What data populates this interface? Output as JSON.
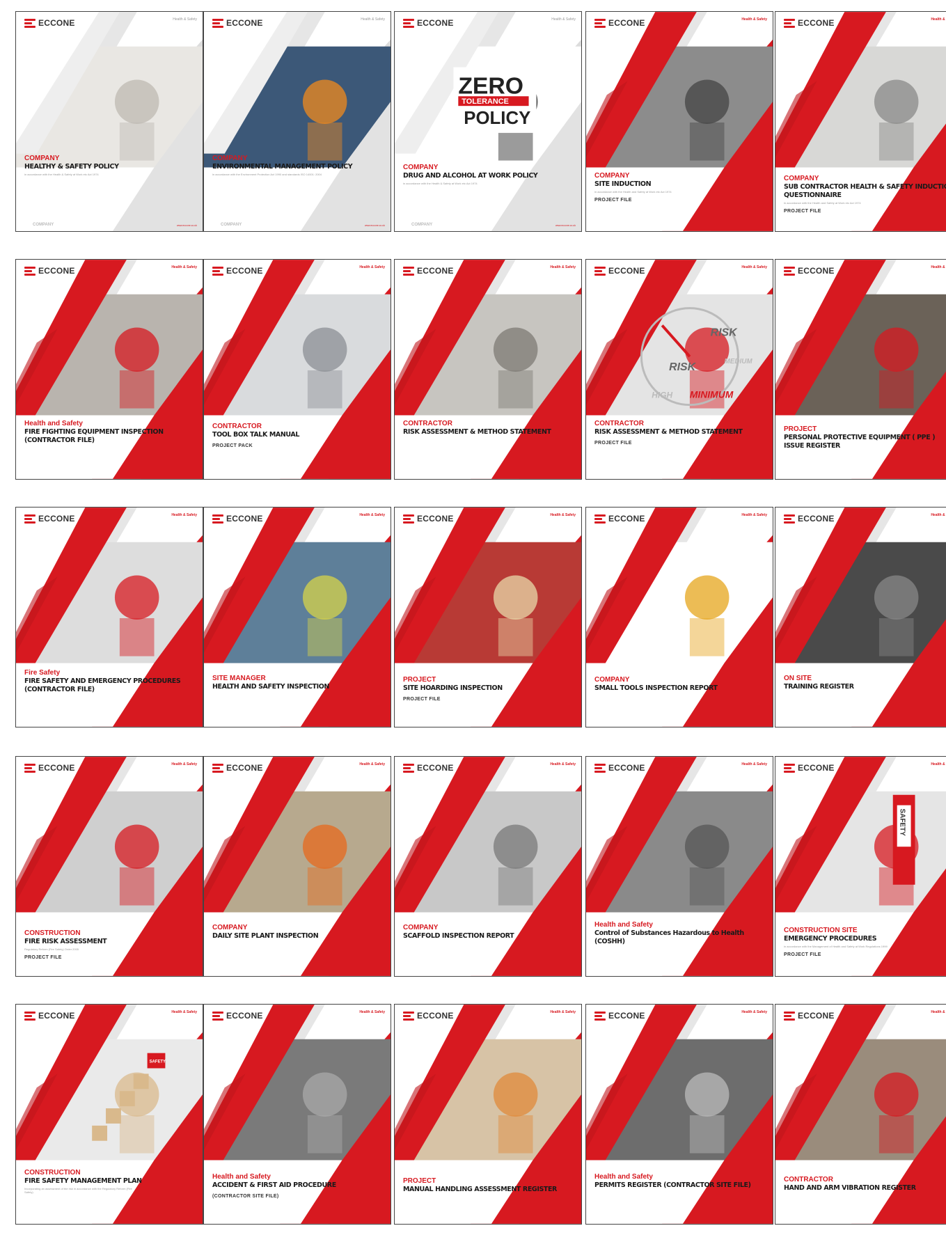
{
  "brand": {
    "logo_text": "ECCONE"
  },
  "covers": [
    {
      "category": "COMPANY",
      "title": "HEALTHY & SAFETY POLICY",
      "subtitle": "in accordance with the Health & Safety at Work etc Act 1974",
      "extra": "",
      "tag": "Health & Safety",
      "footer_left": "COMPANY",
      "footer_right": "www.eccone.co.uk",
      "photo": "pen-on-paper"
    },
    {
      "category": "COMPANY",
      "title": "ENVIRONMENTAL MANAGEMENT POLICY",
      "subtitle": "in accordance with the Environment Protection Act 1990 and standards ISO 14001: 2004",
      "extra": "",
      "tag": "Health & Safety",
      "footer_left": "COMPANY",
      "footer_right": "www.eccone.co.uk",
      "photo": "hard-hat-solar"
    },
    {
      "category": "COMPANY",
      "title": "DRUG AND ALCOHOL AT WORK POLICY",
      "subtitle": "in accordance with the Health & Safety at Work etc Act 1974",
      "extra": "",
      "tag": "Health & Safety",
      "footer_left": "COMPANY",
      "footer_right": "www.eccone.co.uk",
      "photo": "zero-tolerance",
      "poster": {
        "line1": "ZERO",
        "line2": "TOLERANCE",
        "line3": "POLICY"
      }
    },
    {
      "category": "COMPANY",
      "title": "SITE INDUCTION",
      "subtitle": "in accordance with the Health and Safety at Work etc Act 1974",
      "extra": "PROJECT FILE",
      "tag": "Health & Safety",
      "photo": "worker-face"
    },
    {
      "category": "COMPANY",
      "title": "SUB CONTRACTOR HEALTH & SAFETY INDUCTION QUESTIONNAIRE",
      "subtitle": "in accordance with the Health and Safety at Work etc Act 1974",
      "extra": "PROJECT FILE",
      "tag": "Health & Safety",
      "photo": "scaffold-workers"
    },
    {
      "category": "Health and Safety",
      "title": "FIRE FIGHTING EQUIPMENT INSPECTION (CONTRACTOR FILE)",
      "subtitle": "",
      "extra": "",
      "tag": "Health & Safety",
      "photo": "extinguisher-clipboard"
    },
    {
      "category": "CONTRACTOR",
      "title": "TOOL BOX TALK MANUAL",
      "subtitle": "",
      "extra": "PROJECT PACK",
      "tag": "Health & Safety",
      "photo": "engineer-phone"
    },
    {
      "category": "CONTRACTOR",
      "title": "RISK ASSESSMENT & METHOD STATEMENT",
      "subtitle": "",
      "extra": "",
      "tag": "Health & Safety",
      "photo": "construction-site"
    },
    {
      "category": "CONTRACTOR",
      "title": "RISK ASSESSMENT & METHOD STATEMENT",
      "subtitle": "",
      "extra": "PROJECT FILE",
      "tag": "Health & Safety",
      "photo": "risk-gauge",
      "gauge": {
        "a": "RISK",
        "b": "RISK",
        "c": "HIGH",
        "d": "MINIMUM",
        "e": "MEDIUM"
      }
    },
    {
      "category": "PROJECT",
      "title": "PERSONAL PROTECTIVE EQUIPMENT ( PPE ) ISSUE REGISTER",
      "subtitle": "",
      "extra": "",
      "tag": "Health & Safety",
      "photo": "ear-defenders"
    },
    {
      "category": "Fire Safety",
      "title": "FIRE SAFETY AND EMERGENCY PROCEDURES (CONTRACTOR FILE)",
      "subtitle": "",
      "extra": "",
      "tag": "Health & Safety",
      "photo": "extinguishers"
    },
    {
      "category": "SITE MANAGER",
      "title": "HEALTH AND SAFETY INSPECTION",
      "subtitle": "",
      "extra": "",
      "tag": "Health & Safety",
      "photo": "manager-phone"
    },
    {
      "category": "PROJECT",
      "title": "SITE HOARDING INSPECTION",
      "subtitle": "",
      "extra": "PROJECT FILE",
      "tag": "Health & Safety",
      "photo": "hoarding"
    },
    {
      "category": "COMPANY",
      "title": "SMALL TOOLS INSPECTION REPORT",
      "subtitle": "",
      "extra": "",
      "tag": "Health & Safety",
      "photo": "tools-figure"
    },
    {
      "category": "ON SITE",
      "title": "TRAINING REGISTER",
      "subtitle": "",
      "extra": "",
      "tag": "Health & Safety",
      "photo": "trainees"
    },
    {
      "category": "CONSTRUCTION",
      "title": "FIRE RISK ASSESSMENT",
      "subtitle": "Regulatory Reform (Fire Safety) Order 2005",
      "extra": "PROJECT FILE",
      "tag": "Health & Safety",
      "photo": "fire-point"
    },
    {
      "category": "COMPANY",
      "title": "DAILY SITE PLANT INSPECTION",
      "subtitle": "",
      "extra": "",
      "tag": "Health & Safety",
      "photo": "plant-worker"
    },
    {
      "category": "COMPANY",
      "title": "SCAFFOLD INSPECTION REPORT",
      "subtitle": "",
      "extra": "",
      "tag": "Health & Safety",
      "photo": "scaffold"
    },
    {
      "category": "Health and Safety",
      "title": "Control of Substances Hazardous to Health (COSHH)",
      "subtitle": "",
      "extra": "",
      "tag": "Health & Safety",
      "photo": "respirator"
    },
    {
      "category": "CONSTRUCTION SITE",
      "title": "EMERGENCY PROCEDURES",
      "subtitle": "in accordance with the Management of Health and Safety at Work Regulations 1999",
      "extra": "PROJECT FILE",
      "tag": "Health & Safety",
      "photo": "safety-binder",
      "binder_label": "SAFETY"
    },
    {
      "category": "CONSTRUCTION",
      "title": "FIRE SAFETY MANAGEMENT PLAN",
      "subtitle": "Incorporating an assessment of the risk in accordance with the Regulatory Reform (Fire Safety)",
      "extra": "",
      "tag": "Health & Safety",
      "photo": "blocks",
      "block_label": "SAFETY"
    },
    {
      "category": "Health and Safety",
      "title": "ACCIDENT & FIRST AID PROCEDURE",
      "subtitle": "",
      "extra": "(CONTRACTOR SITE FILE)",
      "tag": "Health & Safety",
      "photo": "wall-worker"
    },
    {
      "category": "PROJECT",
      "title": "MANUAL HANDLING ASSESSMENT REGISTER",
      "subtitle": "",
      "extra": "",
      "tag": "Health & Safety",
      "photo": "carrying"
    },
    {
      "category": "Health and Safety",
      "title": "PERMITS REGISTER (CONTRACTOR SITE FILE)",
      "subtitle": "",
      "extra": "",
      "tag": "Health & Safety",
      "photo": "demolition"
    },
    {
      "category": "CONTRACTOR",
      "title": "HAND AND ARM VIBRATION REGISTER",
      "subtitle": "",
      "extra": "",
      "tag": "Health & Safety",
      "photo": "drilling"
    }
  ]
}
